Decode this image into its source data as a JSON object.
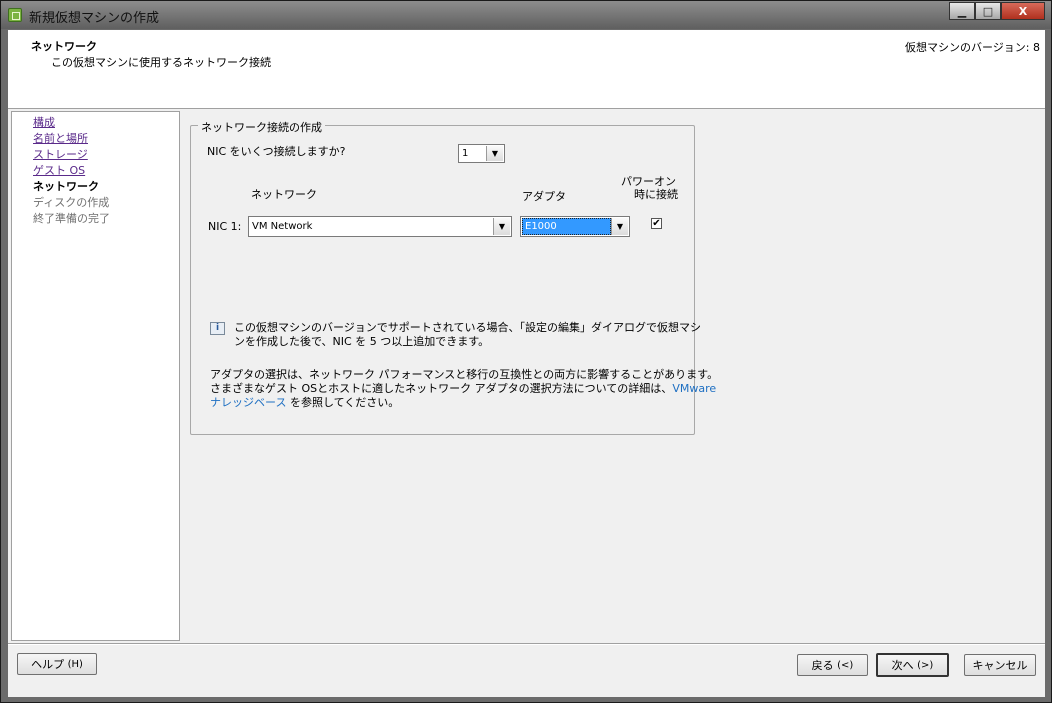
{
  "window": {
    "title": "新規仮想マシンの作成",
    "controls": {
      "minimize": "▁",
      "maximize": "□",
      "close": "X"
    }
  },
  "header": {
    "title": "ネットワーク",
    "subtitle": "この仮想マシンに使用するネットワーク接続",
    "vm_version": "仮想マシンのバージョン: 8"
  },
  "sidebar": {
    "steps": [
      {
        "label": "構成",
        "state": "link"
      },
      {
        "label": "名前と場所",
        "state": "link"
      },
      {
        "label": "ストレージ",
        "state": "link"
      },
      {
        "label": "ゲスト OS",
        "state": "link"
      },
      {
        "label": "ネットワーク",
        "state": "current"
      },
      {
        "label": "ディスクの作成",
        "state": "disabled"
      },
      {
        "label": "終了準備の完了",
        "state": "disabled"
      }
    ]
  },
  "group": {
    "legend": "ネットワーク接続の作成",
    "nic_question": "NIC をいくつ接続しますか?",
    "nic_count": "1",
    "col_network": "ネットワーク",
    "col_adapter": "アダプタ",
    "col_power_line1": "パワーオン",
    "col_power_line2": "時に接続",
    "nic_row_label": "NIC 1:",
    "nic_network": "VM Network",
    "nic_adapter": "E1000",
    "nic_power_checked": true,
    "info_line1": "この仮想マシンのバージョンでサポートされている場合、「設定の編集」ダイアログで仮想マシ",
    "info_line2": "ンを作成した後で、NIC を 5 つ以上追加できます。",
    "adapter_note_line1": "アダプタの選択は、ネットワーク パフォーマンスと移行の互換性との両方に影響することがあります。",
    "adapter_note_line2_pre": "さまざまなゲスト  OSとホストに適したネットワーク アダプタの選択方法についての詳細は、",
    "adapter_note_link1": "VMware",
    "adapter_note_link2": "ナレッジベース",
    "adapter_note_line3_post": " を参照してください。"
  },
  "footer": {
    "help": "ヘルプ",
    "help_key": "(H)",
    "back": "戻る",
    "back_key": "(<)",
    "next": "次へ",
    "next_key": "(>)",
    "cancel": "キャンセル"
  },
  "icons": {
    "app": "vsphere-icon",
    "dropdown": "▼",
    "info": "i",
    "check": "✔"
  }
}
